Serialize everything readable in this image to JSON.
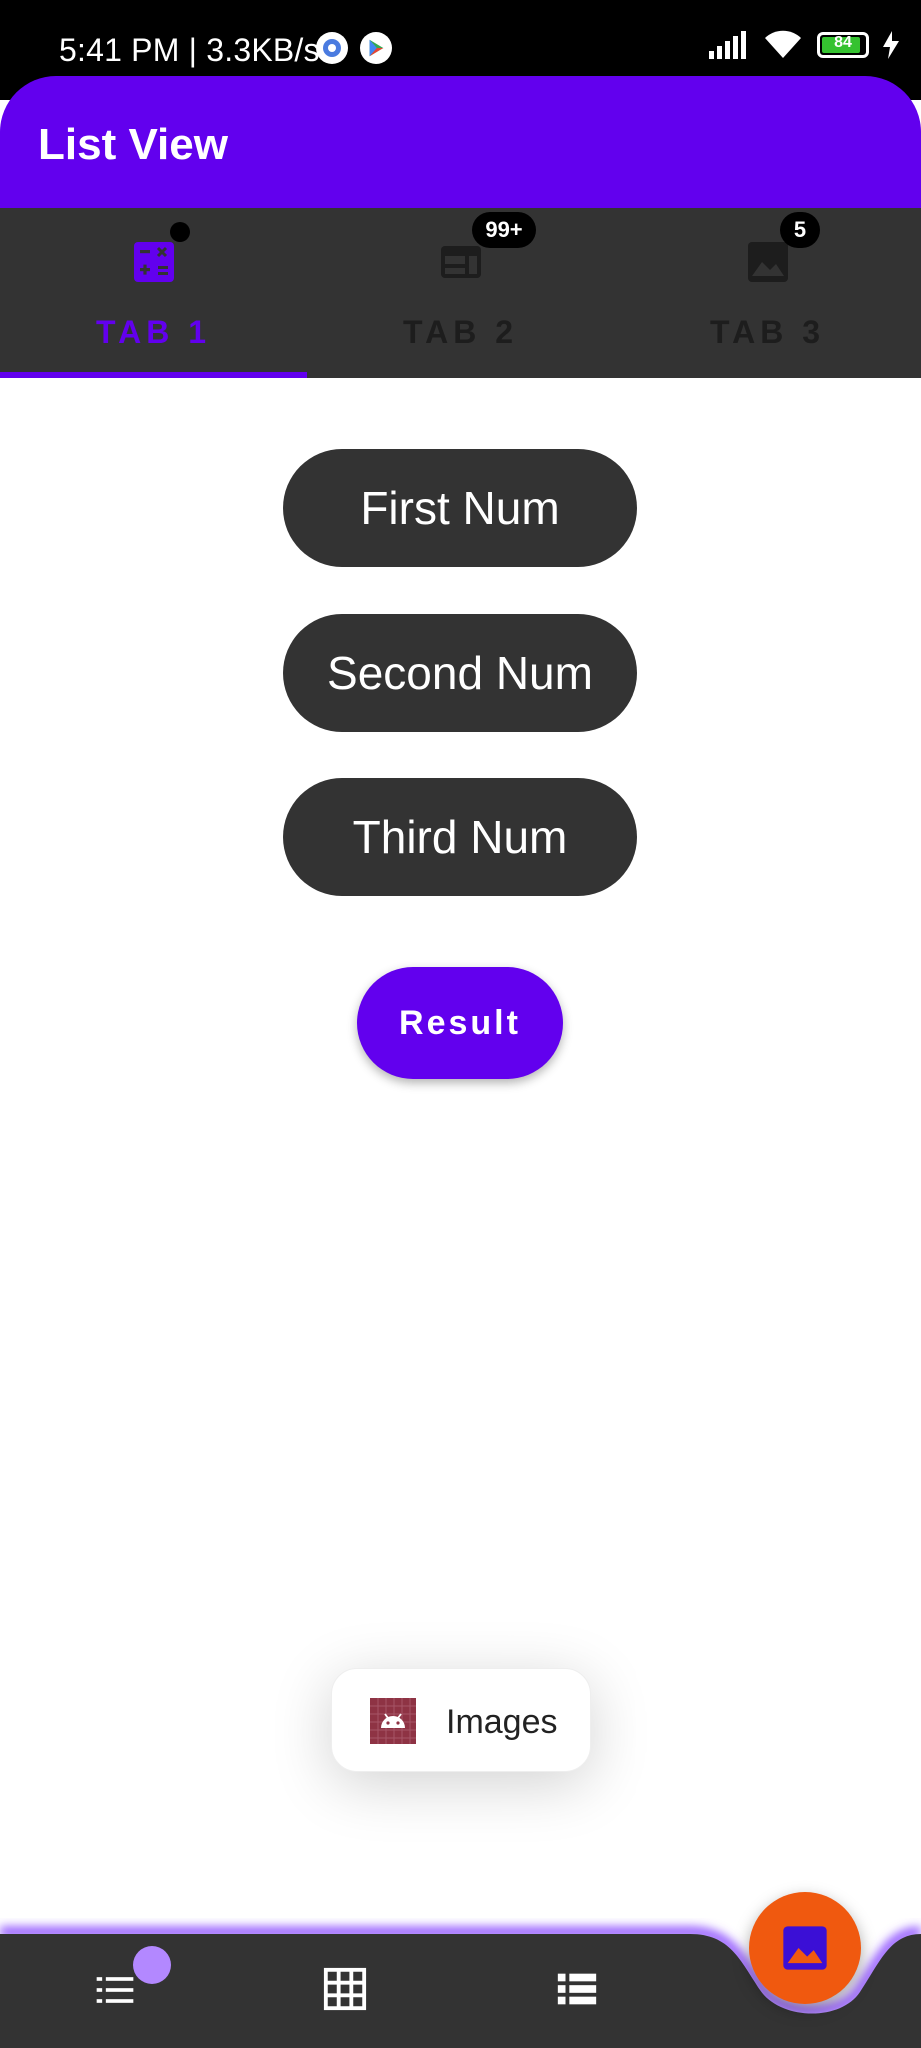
{
  "status_bar": {
    "time": "5:41 PM | 3.3KB/s",
    "battery": "84"
  },
  "app_bar": {
    "title": "List View"
  },
  "tabs": [
    {
      "label": "TAB 1",
      "icon": "calculator-icon",
      "badge": ""
    },
    {
      "label": "TAB 2",
      "icon": "web-icon",
      "badge": "99+"
    },
    {
      "label": "TAB 3",
      "icon": "image-icon",
      "badge": "5"
    }
  ],
  "fields": {
    "first": "First Num",
    "second": "Second Num",
    "third": "Third Num"
  },
  "result_button": {
    "label": "Result"
  },
  "toast": {
    "label": "Images"
  },
  "bottom_nav": {
    "items": [
      "list-icon",
      "grid-icon",
      "view-list-icon"
    ],
    "fab_icon": "image-icon"
  },
  "colors": {
    "primary": "#6200ee",
    "surface_dark": "#333333",
    "fab": "#f0590f",
    "badge_light": "#b388ff"
  }
}
